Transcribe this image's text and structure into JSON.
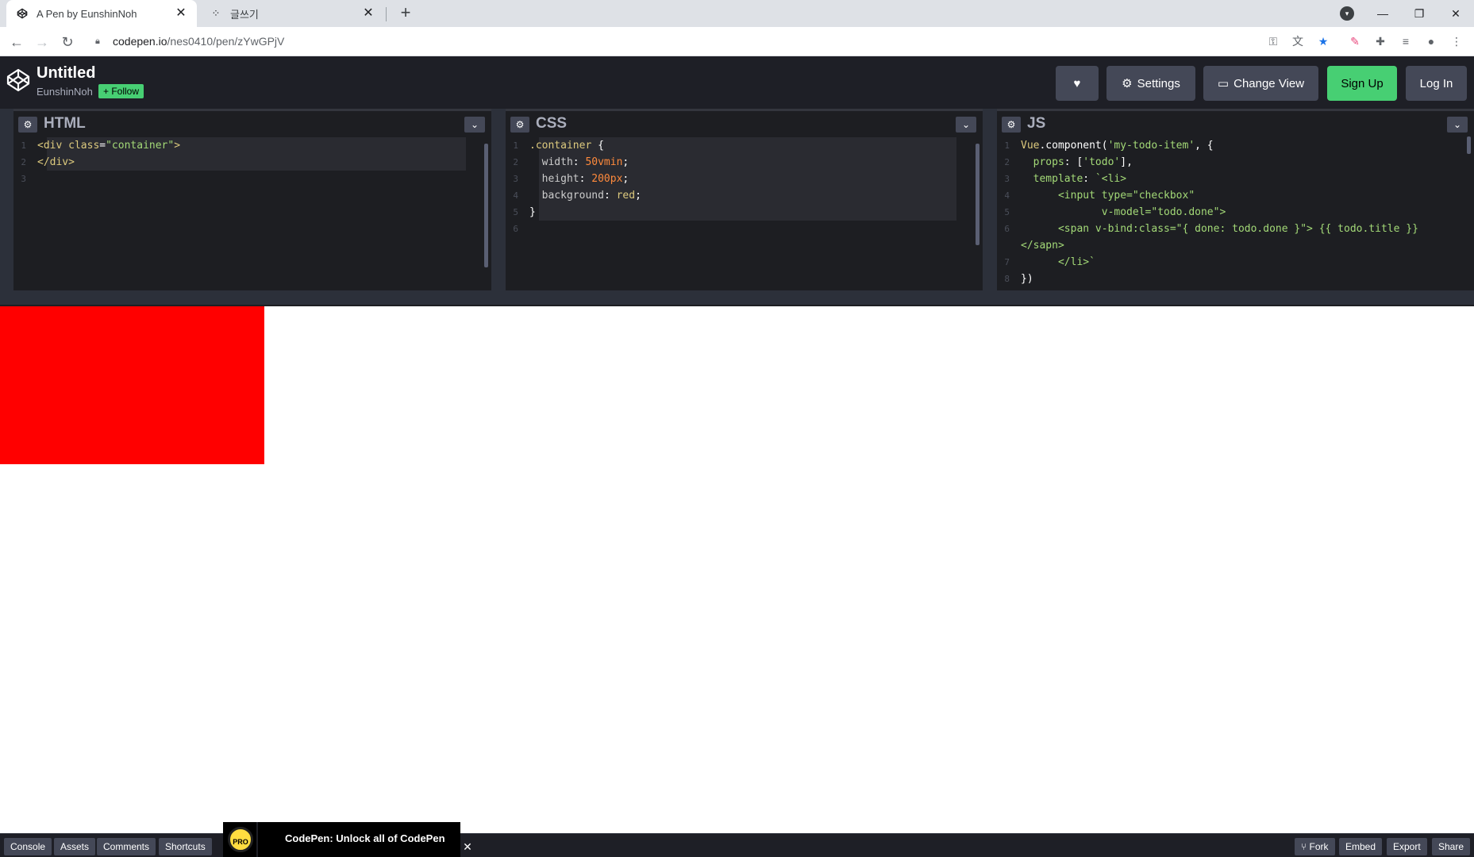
{
  "browser": {
    "tabs": [
      {
        "title": "A Pen by EunshinNoh",
        "icon": "codepen-icon"
      },
      {
        "title": "글쓰기",
        "icon": "app-icon"
      }
    ],
    "url_host": "codepen.io",
    "url_path": "/nes0410/pen/zYwGPjV"
  },
  "header": {
    "title": "Untitled",
    "author": "EunshinNoh",
    "follow_label": "+ Follow",
    "settings_label": "Settings",
    "change_view_label": "Change View",
    "signup_label": "Sign Up",
    "login_label": "Log In"
  },
  "editors": {
    "html": {
      "name": "HTML",
      "lines": [
        "1",
        "2",
        "3"
      ],
      "code": {
        "l1_open": "<div ",
        "l1_attr": "class",
        "l1_eq": "=",
        "l1_val": "\"container\"",
        "l1_close": ">",
        "l2": "</div>"
      }
    },
    "css": {
      "name": "CSS",
      "lines": [
        "1",
        "2",
        "3",
        "4",
        "5",
        "6"
      ],
      "code": {
        "selector": ".container",
        "brace_open": " {",
        "p1": "width",
        "v1": "50vmin",
        "p2": "height",
        "v2": "200px",
        "p3": "background",
        "v3": "red",
        "brace_close": "}"
      }
    },
    "js": {
      "name": "JS",
      "lines": [
        "1",
        "2",
        "3",
        "4",
        "5",
        "6",
        "",
        "7",
        "8"
      ],
      "code": {
        "l1a": "Vue",
        "l1b": ".component(",
        "l1c": "'my-todo-item'",
        "l1d": ", {",
        "l2a": "props",
        "l2b": ": [",
        "l2c": "'todo'",
        "l2d": "],",
        "l3a": "template",
        "l3b": ": ",
        "l3c": "`<li>",
        "l4": "<input type=\"checkbox\"",
        "l5": "v-model=\"todo.done\">",
        "l6": "<span v-bind:class=\"{ done: todo.done }\"> {{ todo.title }}",
        "l6b": "</sapn>",
        "l7": "</li>`",
        "l8": "})"
      }
    }
  },
  "footer": {
    "console": "Console",
    "assets": "Assets",
    "comments": "Comments",
    "shortcuts": "Shortcuts",
    "promo_badge": "PRO",
    "promo_text": "CodePen: Unlock all of CodePen",
    "fork": "Fork",
    "embed": "Embed",
    "export": "Export",
    "share": "Share"
  },
  "colors": {
    "header_bg": "#1e1f26",
    "editor_bg": "#1d1e22",
    "accent_green": "#47cf73",
    "preview_box": "#ff0000"
  }
}
